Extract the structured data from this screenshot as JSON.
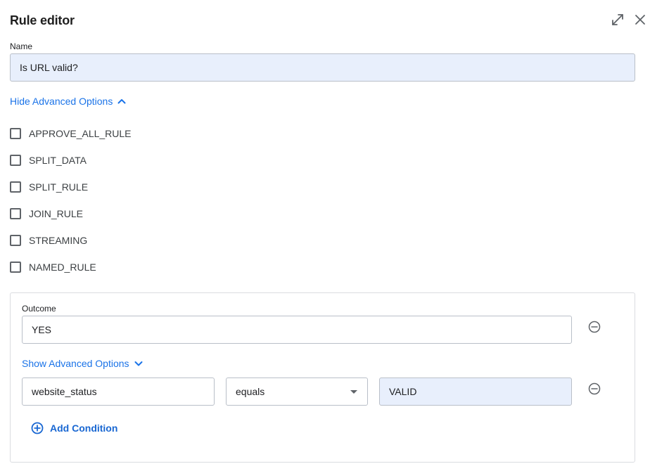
{
  "dialog": {
    "title": "Rule editor",
    "icons": {
      "expand": "expand-icon",
      "close": "close-icon"
    }
  },
  "name": {
    "label": "Name",
    "value": "Is URL valid?"
  },
  "advanced": {
    "hide_label": "Hide Advanced Options",
    "options": [
      {
        "label": "APPROVE_ALL_RULE",
        "checked": false
      },
      {
        "label": "SPLIT_DATA",
        "checked": false
      },
      {
        "label": "SPLIT_RULE",
        "checked": false
      },
      {
        "label": "JOIN_RULE",
        "checked": false
      },
      {
        "label": "STREAMING",
        "checked": false
      },
      {
        "label": "NAMED_RULE",
        "checked": false
      }
    ]
  },
  "outcome": {
    "label": "Outcome",
    "value": "YES",
    "show_advanced_label": "Show Advanced Options",
    "condition": {
      "field": "website_status",
      "operator": "equals",
      "value": "VALID"
    },
    "add_condition_label": "Add Condition"
  },
  "colors": {
    "accent": "#1a73e8",
    "input_filled_bg": "#e8effc",
    "border": "#dadce0"
  }
}
